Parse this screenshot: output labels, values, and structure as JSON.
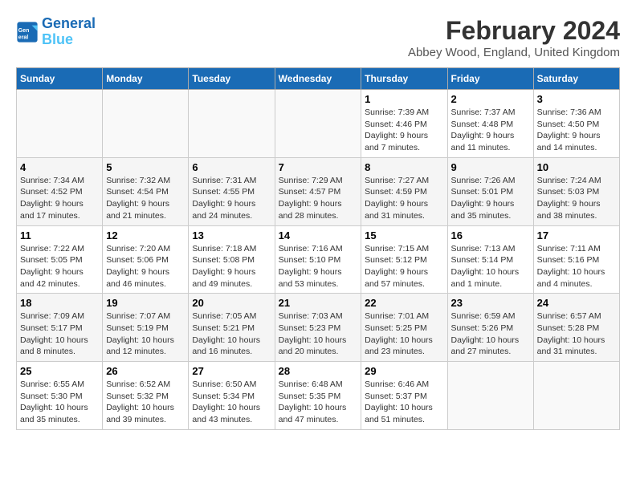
{
  "logo": {
    "line1": "General",
    "line2": "Blue"
  },
  "title": "February 2024",
  "subtitle": "Abbey Wood, England, United Kingdom",
  "headers": [
    "Sunday",
    "Monday",
    "Tuesday",
    "Wednesday",
    "Thursday",
    "Friday",
    "Saturday"
  ],
  "weeks": [
    [
      {
        "day": "",
        "info": ""
      },
      {
        "day": "",
        "info": ""
      },
      {
        "day": "",
        "info": ""
      },
      {
        "day": "",
        "info": ""
      },
      {
        "day": "1",
        "info": "Sunrise: 7:39 AM\nSunset: 4:46 PM\nDaylight: 9 hours\nand 7 minutes."
      },
      {
        "day": "2",
        "info": "Sunrise: 7:37 AM\nSunset: 4:48 PM\nDaylight: 9 hours\nand 11 minutes."
      },
      {
        "day": "3",
        "info": "Sunrise: 7:36 AM\nSunset: 4:50 PM\nDaylight: 9 hours\nand 14 minutes."
      }
    ],
    [
      {
        "day": "4",
        "info": "Sunrise: 7:34 AM\nSunset: 4:52 PM\nDaylight: 9 hours\nand 17 minutes."
      },
      {
        "day": "5",
        "info": "Sunrise: 7:32 AM\nSunset: 4:54 PM\nDaylight: 9 hours\nand 21 minutes."
      },
      {
        "day": "6",
        "info": "Sunrise: 7:31 AM\nSunset: 4:55 PM\nDaylight: 9 hours\nand 24 minutes."
      },
      {
        "day": "7",
        "info": "Sunrise: 7:29 AM\nSunset: 4:57 PM\nDaylight: 9 hours\nand 28 minutes."
      },
      {
        "day": "8",
        "info": "Sunrise: 7:27 AM\nSunset: 4:59 PM\nDaylight: 9 hours\nand 31 minutes."
      },
      {
        "day": "9",
        "info": "Sunrise: 7:26 AM\nSunset: 5:01 PM\nDaylight: 9 hours\nand 35 minutes."
      },
      {
        "day": "10",
        "info": "Sunrise: 7:24 AM\nSunset: 5:03 PM\nDaylight: 9 hours\nand 38 minutes."
      }
    ],
    [
      {
        "day": "11",
        "info": "Sunrise: 7:22 AM\nSunset: 5:05 PM\nDaylight: 9 hours\nand 42 minutes."
      },
      {
        "day": "12",
        "info": "Sunrise: 7:20 AM\nSunset: 5:06 PM\nDaylight: 9 hours\nand 46 minutes."
      },
      {
        "day": "13",
        "info": "Sunrise: 7:18 AM\nSunset: 5:08 PM\nDaylight: 9 hours\nand 49 minutes."
      },
      {
        "day": "14",
        "info": "Sunrise: 7:16 AM\nSunset: 5:10 PM\nDaylight: 9 hours\nand 53 minutes."
      },
      {
        "day": "15",
        "info": "Sunrise: 7:15 AM\nSunset: 5:12 PM\nDaylight: 9 hours\nand 57 minutes."
      },
      {
        "day": "16",
        "info": "Sunrise: 7:13 AM\nSunset: 5:14 PM\nDaylight: 10 hours\nand 1 minute."
      },
      {
        "day": "17",
        "info": "Sunrise: 7:11 AM\nSunset: 5:16 PM\nDaylight: 10 hours\nand 4 minutes."
      }
    ],
    [
      {
        "day": "18",
        "info": "Sunrise: 7:09 AM\nSunset: 5:17 PM\nDaylight: 10 hours\nand 8 minutes."
      },
      {
        "day": "19",
        "info": "Sunrise: 7:07 AM\nSunset: 5:19 PM\nDaylight: 10 hours\nand 12 minutes."
      },
      {
        "day": "20",
        "info": "Sunrise: 7:05 AM\nSunset: 5:21 PM\nDaylight: 10 hours\nand 16 minutes."
      },
      {
        "day": "21",
        "info": "Sunrise: 7:03 AM\nSunset: 5:23 PM\nDaylight: 10 hours\nand 20 minutes."
      },
      {
        "day": "22",
        "info": "Sunrise: 7:01 AM\nSunset: 5:25 PM\nDaylight: 10 hours\nand 23 minutes."
      },
      {
        "day": "23",
        "info": "Sunrise: 6:59 AM\nSunset: 5:26 PM\nDaylight: 10 hours\nand 27 minutes."
      },
      {
        "day": "24",
        "info": "Sunrise: 6:57 AM\nSunset: 5:28 PM\nDaylight: 10 hours\nand 31 minutes."
      }
    ],
    [
      {
        "day": "25",
        "info": "Sunrise: 6:55 AM\nSunset: 5:30 PM\nDaylight: 10 hours\nand 35 minutes."
      },
      {
        "day": "26",
        "info": "Sunrise: 6:52 AM\nSunset: 5:32 PM\nDaylight: 10 hours\nand 39 minutes."
      },
      {
        "day": "27",
        "info": "Sunrise: 6:50 AM\nSunset: 5:34 PM\nDaylight: 10 hours\nand 43 minutes."
      },
      {
        "day": "28",
        "info": "Sunrise: 6:48 AM\nSunset: 5:35 PM\nDaylight: 10 hours\nand 47 minutes."
      },
      {
        "day": "29",
        "info": "Sunrise: 6:46 AM\nSunset: 5:37 PM\nDaylight: 10 hours\nand 51 minutes."
      },
      {
        "day": "",
        "info": ""
      },
      {
        "day": "",
        "info": ""
      }
    ]
  ]
}
